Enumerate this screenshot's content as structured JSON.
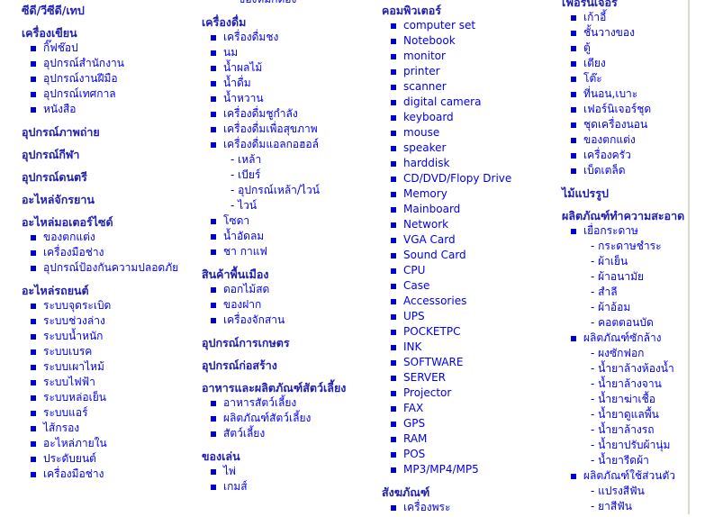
{
  "columns": [
    {
      "groups": [
        {
          "heading": "ซีดี/วีซีดี/เทป",
          "items": []
        },
        {
          "heading": "เครื่องเขียน",
          "items": [
            {
              "label": "กิ๊ฟช๊อป"
            },
            {
              "label": "อุปกรณ์สำนักงาน"
            },
            {
              "label": "อุปกรณ์งานฝีมือ"
            },
            {
              "label": "อุปกรณ์เทศกาล"
            },
            {
              "label": "หนังสือ"
            }
          ]
        },
        {
          "heading": "อุปกรณ์ภาพถ่าย",
          "items": []
        },
        {
          "heading": "อุปกรณ์กีฬา",
          "items": []
        },
        {
          "heading": "อุปกรณ์ดนตรี",
          "items": []
        },
        {
          "heading": "อะไหล่จักรยาน",
          "items": []
        },
        {
          "heading": "อะไหล่มอเตอร์ไซด์",
          "items": [
            {
              "label": "ของตกแต่ง"
            },
            {
              "label": "เครื่องมือช่าง"
            },
            {
              "label": "อุปกรณ์ป้องกันความปลอดภัย",
              "wrap": true
            }
          ]
        },
        {
          "heading": "อะไหล่รถยนต์",
          "items": [
            {
              "label": "ระบบจุดระเบิด"
            },
            {
              "label": "ระบบช่วงล่าง"
            },
            {
              "label": "ระบบน้ำหนัก"
            },
            {
              "label": "ระบบเบรค"
            },
            {
              "label": "ระบบเผาไหม้"
            },
            {
              "label": "ระบบไฟฟ้า"
            },
            {
              "label": "ระบบหล่อเย็น"
            },
            {
              "label": "ระบบแอร์"
            },
            {
              "label": "ไส้กรอง"
            },
            {
              "label": "อะไหล่ภายใน"
            },
            {
              "label": "ประดับยนต์"
            },
            {
              "label": "เครื่องมือช่าง"
            }
          ]
        }
      ]
    },
    {
      "groups": [
        {
          "heading": "",
          "items": [
            {
              "label": "- ของหมักดอง",
              "sub": true
            }
          ]
        },
        {
          "heading": "เครื่องดื่ม",
          "items": [
            {
              "label": "เครื่องดื่มชง"
            },
            {
              "label": "นม"
            },
            {
              "label": "น้ำผลไม้"
            },
            {
              "label": "น้ำดื่ม"
            },
            {
              "label": "น้ำหวาน"
            },
            {
              "label": "เครื่องดื่มชูกำลัง"
            },
            {
              "label": "เครื่องดื่มเพื่อสุขภาพ"
            },
            {
              "label": "เครื่องดื่มแอลกอฮอล์"
            },
            {
              "label": "- เหล้า",
              "sub": true
            },
            {
              "label": "- เบียร์",
              "sub": true
            },
            {
              "label": "- อุปกรณ์เหล้า/ไวน์",
              "sub": true
            },
            {
              "label": "- ไวน์",
              "sub": true
            },
            {
              "label": "โซดา"
            },
            {
              "label": "น้ำอัดลม"
            },
            {
              "label": "ชา กาแฟ"
            }
          ]
        },
        {
          "heading": "สินค้าพื้นเมือง",
          "items": [
            {
              "label": "ดอกไม้สด"
            },
            {
              "label": "ของฝาก"
            },
            {
              "label": "เครื่องจักสาน"
            }
          ]
        },
        {
          "heading": "อุปกรณ์การเกษตร",
          "items": []
        },
        {
          "heading": "อุปกรณ์ก่อสร้าง",
          "items": []
        },
        {
          "heading": "อาหารและผลิตภัณฑ์สัตว์เลี้ยง",
          "items": [
            {
              "label": "อาหารสัตว์เลี้ยง"
            },
            {
              "label": "ผลิตภัณฑ์สัตว์เลี้ยง"
            },
            {
              "label": "สัตว์เลี้ยง"
            }
          ]
        },
        {
          "heading": "ของเล่น",
          "items": [
            {
              "label": "ไพ่"
            },
            {
              "label": "เกมส์"
            }
          ]
        }
      ]
    },
    {
      "groups": [
        {
          "heading": "คอมพิวเตอร์",
          "items": [
            {
              "label": "computer set"
            },
            {
              "label": "Notebook"
            },
            {
              "label": "monitor"
            },
            {
              "label": "printer"
            },
            {
              "label": "scanner"
            },
            {
              "label": "digital camera"
            },
            {
              "label": "keyboard"
            },
            {
              "label": "mouse"
            },
            {
              "label": "speaker"
            },
            {
              "label": "harddisk"
            },
            {
              "label": "CD/DVD/Flopy Drive"
            },
            {
              "label": "Memory"
            },
            {
              "label": "Mainboard"
            },
            {
              "label": "Network"
            },
            {
              "label": "VGA Card"
            },
            {
              "label": "Sound Card"
            },
            {
              "label": "CPU"
            },
            {
              "label": "Case"
            },
            {
              "label": "Accessories"
            },
            {
              "label": "UPS"
            },
            {
              "label": "POCKETPC"
            },
            {
              "label": "INK"
            },
            {
              "label": "SOFTWARE"
            },
            {
              "label": "SERVER"
            },
            {
              "label": "Projector"
            },
            {
              "label": "FAX"
            },
            {
              "label": "GPS"
            },
            {
              "label": "RAM"
            },
            {
              "label": "POS"
            },
            {
              "label": "MP3/MP4/MP5"
            }
          ]
        },
        {
          "heading": "สังฆภัณฑ์",
          "items": [
            {
              "label": "เครื่องพระ"
            }
          ]
        }
      ]
    },
    {
      "groups": [
        {
          "heading": "เฟอร์นิเจอร์",
          "items": [
            {
              "label": "เก้าอี้"
            },
            {
              "label": "ชั้นวางของ"
            },
            {
              "label": "ตู้"
            },
            {
              "label": "เตียง"
            },
            {
              "label": "โต๊ะ"
            },
            {
              "label": "ที่นอน,เบาะ"
            },
            {
              "label": "เฟอร์นิเจอร์ชุด"
            },
            {
              "label": "ชุดเครื่องนอน"
            },
            {
              "label": "ของตกแต่ง"
            },
            {
              "label": "เครื่องครัว"
            },
            {
              "label": "เบ็ดเตล็ด"
            }
          ]
        },
        {
          "heading": "ไม้แปรรูป",
          "items": []
        },
        {
          "heading": "ผลิตภัณฑ์ทำความสะอาด",
          "items": [
            {
              "label": "เยื่อกระดาษ"
            },
            {
              "label": "- กระดาษชำระ",
              "sub": true
            },
            {
              "label": "- ผ้าเย็น",
              "sub": true
            },
            {
              "label": "- ผ้าอนามัย",
              "sub": true
            },
            {
              "label": "- สำลี",
              "sub": true
            },
            {
              "label": "- ผ้าอ้อม",
              "sub": true
            },
            {
              "label": "- คอตตอนบัด",
              "sub": true
            },
            {
              "label": "ผลิตภัณฑ์ซักล้าง"
            },
            {
              "label": "- ผงซักฟอก",
              "sub": true
            },
            {
              "label": "- น้ำยาล้างห้องน้ำ",
              "sub": true
            },
            {
              "label": "- น้ำยาล้างจาน",
              "sub": true
            },
            {
              "label": "- น้ำยาฆ่าเชื้อ",
              "sub": true
            },
            {
              "label": "- น้ำยาดูแลพื้น",
              "sub": true
            },
            {
              "label": "- น้ำยาล้างรถ",
              "sub": true
            },
            {
              "label": "- น้ำยาปรับผ้านุ่ม",
              "sub": true
            },
            {
              "label": "- น้ำยารีดผ้า",
              "sub": true
            },
            {
              "label": "ผลิตภัณฑ์ใช้ส่วนตัว"
            },
            {
              "label": "- แปรงสีฟัน",
              "sub": true
            },
            {
              "label": "- ยาสีฟัน",
              "sub": true
            }
          ]
        }
      ]
    }
  ],
  "colors": {
    "heading": "#1f1fb0",
    "link": "#0000ee",
    "bullet": "#0000cc",
    "divider": "#d8d8cc"
  }
}
